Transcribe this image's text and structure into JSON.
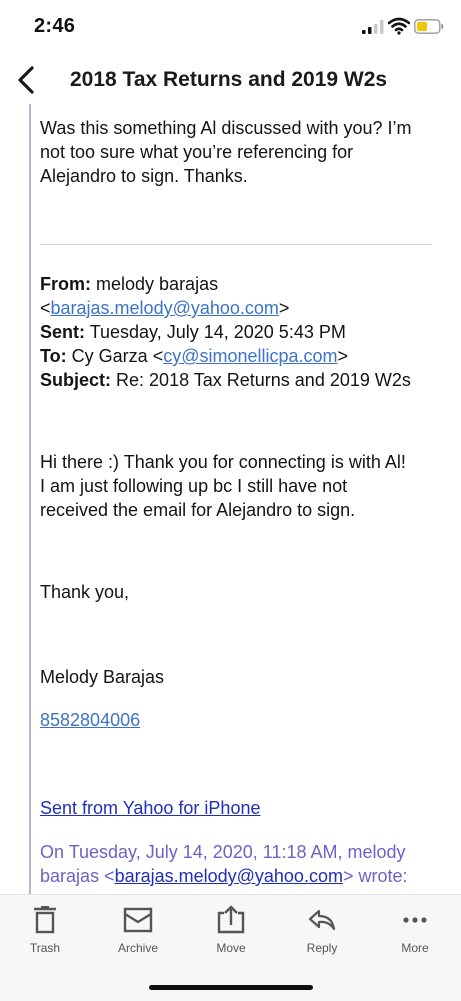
{
  "status_bar": {
    "time": "2:46"
  },
  "nav": {
    "title": "2018 Tax Returns and 2019 W2s"
  },
  "email": {
    "reply_text_line1": "Was this something Al discussed with you? I’m",
    "reply_text_line2": "not too sure what you’re referencing for",
    "reply_text_line3": "Alejandro to sign. Thanks.",
    "header": {
      "from_label": "From:",
      "from_name": "melody barajas",
      "from_email": "barajas.melody@yahoo.com",
      "sent_label": "Sent:",
      "sent_value": "Tuesday, July 14, 2020 5:43 PM",
      "to_label": "To:",
      "to_name": "Cy Garza",
      "to_email": "cy@simonellicpa.com",
      "subject_label": "Subject:",
      "subject_value": "Re: 2018 Tax Returns and 2019 W2s"
    },
    "body_line1": "Hi there :) Thank you for connecting is with Al!",
    "body_line2": "I am just following up bc I still have not",
    "body_line3": "received the email for Alejandro to sign.",
    "closing": "Thank you,",
    "signature": "Melody Barajas",
    "phone": "8582804006",
    "sent_from": "Sent from Yahoo for iPhone",
    "quoted_line1": "On Tuesday, July 14, 2020, 11:18 AM, melody",
    "quoted_line2_prefix": "barajas <",
    "quoted_email": "barajas.melody@yahoo.com",
    "quoted_line2_suffix": "> wrote:"
  },
  "toolbar": {
    "trash": "Trash",
    "archive": "Archive",
    "move": "Move",
    "reply": "Reply",
    "more": "More"
  },
  "colors": {
    "link": "#3d73c9",
    "sent_from_link": "#1e2fb8",
    "quoted_text": "#6b63c6",
    "quote_bar": "#b7b2d8",
    "toolbar_icon": "#555555"
  },
  "icons": {
    "back": "chevron-left-icon",
    "trash": "trash-icon",
    "archive": "archive-icon",
    "move": "move-icon",
    "reply": "reply-icon",
    "more": "more-icon"
  }
}
